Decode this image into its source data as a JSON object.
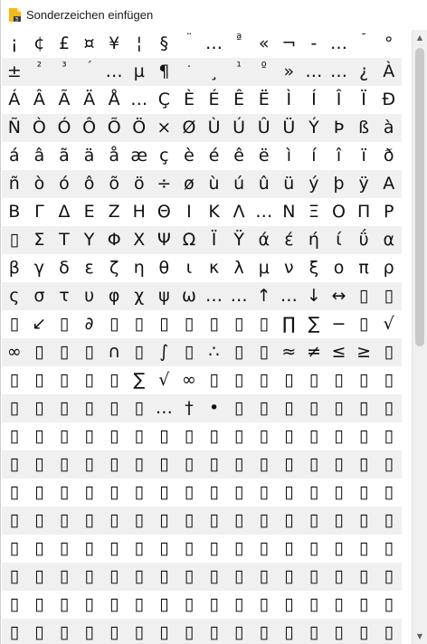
{
  "window": {
    "title": "Sonderzeichen einfügen",
    "app_icon": "document-icon",
    "accent_color": "#f5b915"
  },
  "grid": {
    "rows": [
      [
        "¡",
        "¢",
        "£",
        "¤",
        "¥",
        "¦",
        "§",
        "¨",
        "…",
        "ª",
        "«",
        "¬",
        "-",
        "…",
        "¯",
        "°"
      ],
      [
        "±",
        "²",
        "³",
        "´",
        "…",
        "µ",
        "¶",
        "·",
        "¸",
        "¹",
        "º",
        "»",
        "…",
        "…",
        "¿",
        "À"
      ],
      [
        "Á",
        "Â",
        "Ã",
        "Ä",
        "Å",
        "…",
        "Ç",
        "È",
        "É",
        "Ê",
        "Ë",
        "Ì",
        "Í",
        "Î",
        "Ï",
        "Ð"
      ],
      [
        "Ñ",
        "Ò",
        "Ó",
        "Ô",
        "Õ",
        "Ö",
        "×",
        "Ø",
        "Ù",
        "Ú",
        "Û",
        "Ü",
        "Ý",
        "Þ",
        "ß",
        "à"
      ],
      [
        "á",
        "â",
        "ã",
        "ä",
        "å",
        "æ",
        "ç",
        "è",
        "é",
        "ê",
        "ë",
        "ì",
        "í",
        "î",
        "ï",
        "ð"
      ],
      [
        "ñ",
        "ò",
        "ó",
        "ô",
        "õ",
        "ö",
        "÷",
        "ø",
        "ù",
        "ú",
        "û",
        "ü",
        "ý",
        "þ",
        "ÿ",
        "A"
      ],
      [
        "Β",
        "Γ",
        "Δ",
        "Ε",
        "Ζ",
        "Η",
        "Θ",
        "Ι",
        "Κ",
        "Λ",
        "…",
        "Ν",
        "Ξ",
        "Ο",
        "Π",
        "Ρ"
      ],
      [
        "▯",
        "Σ",
        "Τ",
        "Υ",
        "Φ",
        "Χ",
        "Ψ",
        "Ω",
        "Ϊ",
        "Ϋ",
        "ά",
        "έ",
        "ή",
        "ί",
        "ΰ",
        "α"
      ],
      [
        "β",
        "γ",
        "δ",
        "ε",
        "ζ",
        "η",
        "θ",
        "ι",
        "κ",
        "λ",
        "μ",
        "ν",
        "ξ",
        "ο",
        "π",
        "ρ"
      ],
      [
        "ς",
        "σ",
        "τ",
        "υ",
        "φ",
        "χ",
        "ψ",
        "ω",
        "…",
        "…",
        "↑",
        "…",
        "↓",
        "↔",
        "▯",
        "▯",
        "↗"
      ],
      [
        "▯",
        "↙",
        "▯",
        "∂",
        "▯",
        "▯",
        "▯",
        "▯",
        "▯",
        "▯",
        "▯",
        "∏",
        "∑",
        "−",
        "▯",
        "√",
        "▯"
      ],
      [
        "∞",
        "▯",
        "▯",
        "▯",
        "∩",
        "▯",
        "∫",
        "▯",
        "∴",
        "▯",
        "▯",
        "≈",
        "≠",
        "≤",
        "≥",
        "▯"
      ],
      [
        "▯",
        "▯",
        "▯",
        "▯",
        "▯",
        "∑",
        "√",
        "∞",
        "▯",
        "▯",
        "▯",
        "▯",
        "▯",
        "▯",
        "▯",
        "▯"
      ],
      [
        "▯",
        "▯",
        "▯",
        "▯",
        "▯",
        "▯",
        "…",
        "†",
        "•",
        "▯",
        "▯",
        "▯",
        "▯",
        "▯",
        "▯",
        "▯"
      ],
      [
        "▯",
        "▯",
        "▯",
        "▯",
        "▯",
        "▯",
        "▯",
        "▯",
        "▯",
        "▯",
        "▯",
        "▯",
        "▯",
        "▯",
        "▯",
        "▯"
      ],
      [
        "▯",
        "▯",
        "▯",
        "▯",
        "▯",
        "▯",
        "▯",
        "▯",
        "▯",
        "▯",
        "▯",
        "▯",
        "▯",
        "▯",
        "▯",
        "▯"
      ],
      [
        "▯",
        "▯",
        "▯",
        "▯",
        "▯",
        "▯",
        "▯",
        "▯",
        "▯",
        "▯",
        "▯",
        "▯",
        "▯",
        "▯",
        "▯",
        "▯"
      ],
      [
        "▯",
        "▯",
        "▯",
        "▯",
        "▯",
        "▯",
        "▯",
        "▯",
        "▯",
        "▯",
        "▯",
        "▯",
        "▯",
        "▯",
        "▯",
        "▯"
      ],
      [
        "▯",
        "▯",
        "▯",
        "▯",
        "▯",
        "▯",
        "▯",
        "▯",
        "▯",
        "▯",
        "▯",
        "▯",
        "▯",
        "▯",
        "▯",
        "▯"
      ],
      [
        "▯",
        "▯",
        "▯",
        "▯",
        "▯",
        "▯",
        "▯",
        "▯",
        "▯",
        "▯",
        "▯",
        "▯",
        "▯",
        "▯",
        "▯",
        "▯"
      ],
      [
        "▯",
        "▯",
        "▯",
        "▯",
        "▯",
        "▯",
        "▯",
        "▯",
        "▯",
        "▯",
        "▯",
        "▯",
        "▯",
        "▯",
        "▯",
        "▯"
      ],
      [
        "▯",
        "▯",
        "▯",
        "▯",
        "▯",
        "▯",
        "▯",
        "▯",
        "▯",
        "▯",
        "▯",
        "▯",
        "▯",
        "▯",
        "▯",
        "▯"
      ]
    ]
  },
  "scrollbar": {
    "up_icon": "chevron-up-icon",
    "down_icon": "chevron-down-icon"
  }
}
